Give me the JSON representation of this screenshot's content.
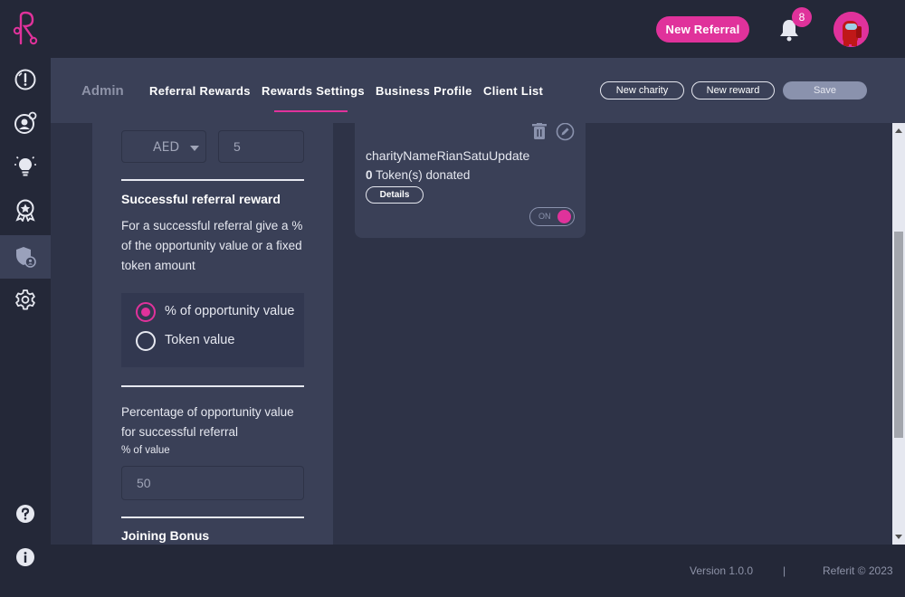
{
  "header": {
    "new_referral_label": "New Referral",
    "notification_count": "8",
    "accent_color": "#e0329b"
  },
  "sidebar": {
    "items": [
      {
        "icon": "info-gauge-icon"
      },
      {
        "icon": "user-refer-icon"
      },
      {
        "icon": "lightbulb-icon"
      },
      {
        "icon": "award-icon"
      },
      {
        "icon": "shield-user-icon",
        "active": true
      },
      {
        "icon": "gear-icon"
      }
    ],
    "bottom_items": [
      {
        "icon": "help-icon"
      },
      {
        "icon": "info-icon"
      }
    ]
  },
  "admin_bar": {
    "title": "Admin",
    "tabs": [
      {
        "label": "Referral Rewards"
      },
      {
        "label": "Rewards Settings",
        "active": true
      },
      {
        "label": "Business Profile"
      },
      {
        "label": "Client List"
      }
    ],
    "new_charity_label": "New charity",
    "new_reward_label": "New reward",
    "save_label": "Save"
  },
  "settings": {
    "currency": "AED",
    "currency_amount": "5",
    "successful_referral": {
      "heading": "Successful referral reward",
      "description": "For a successful referral give a % of the opportunity value or a fixed token amount",
      "options": [
        {
          "label": "% of opportunity value",
          "selected": true
        },
        {
          "label": "Token value",
          "selected": false
        }
      ]
    },
    "percentage": {
      "heading": "Percentage of opportunity value for successful referral",
      "field_label": "% of value",
      "value": "50"
    },
    "joining_bonus_heading": "Joining Bonus"
  },
  "charity_card": {
    "name": "charityNameRianSatuUpdate",
    "token_count": "0",
    "token_suffix": " Token(s) donated",
    "details_label": "Details",
    "toggle_label": "ON",
    "toggle_on": true
  },
  "footer": {
    "version": "Version 1.0.0",
    "separator": "|",
    "copyright": "Referit © 2023"
  }
}
